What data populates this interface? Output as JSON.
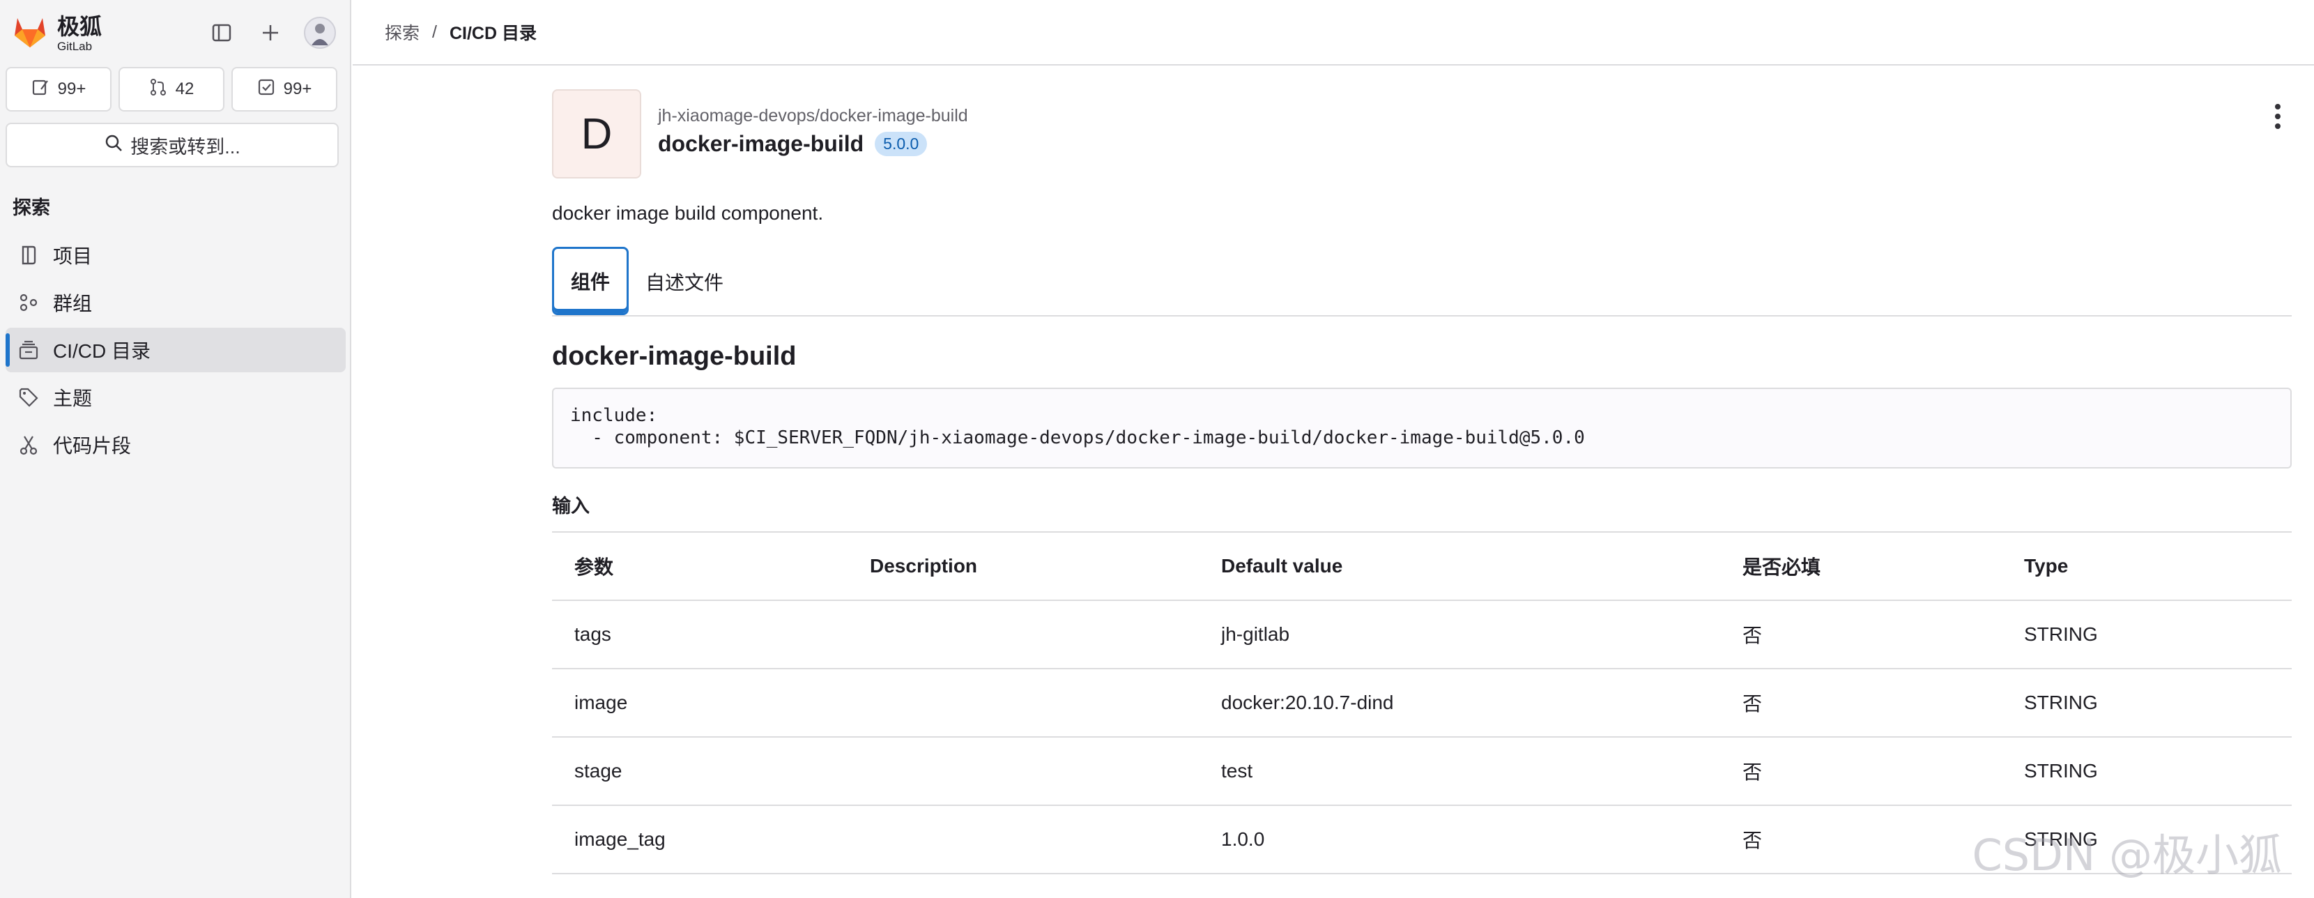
{
  "brand": {
    "name_cn": "极狐",
    "name_en": "GitLab"
  },
  "counters": [
    {
      "icon": "issues-icon",
      "value": "99+"
    },
    {
      "icon": "merge-request-icon",
      "value": "42"
    },
    {
      "icon": "todo-icon",
      "value": "99+"
    }
  ],
  "search": {
    "label": "搜索或转到..."
  },
  "sidebar": {
    "section": "探索",
    "items": [
      {
        "label": "项目",
        "icon": "project-icon"
      },
      {
        "label": "群组",
        "icon": "group-icon"
      },
      {
        "label": "CI/CD 目录",
        "icon": "catalog-icon",
        "active": true
      },
      {
        "label": "主题",
        "icon": "label-icon"
      },
      {
        "label": "代码片段",
        "icon": "snippet-icon"
      }
    ]
  },
  "breadcrumb": {
    "parent": "探索",
    "separator": "/",
    "current": "CI/CD 目录"
  },
  "project": {
    "avatar_letter": "D",
    "path": "jh-xiaomage-devops/docker-image-build",
    "name": "docker-image-build",
    "version": "5.0.0",
    "description": "docker image build component."
  },
  "tabs": [
    {
      "label": "组件",
      "active": true
    },
    {
      "label": "自述文件",
      "active": false
    }
  ],
  "component": {
    "title": "docker-image-build",
    "code": "include:\n  - component: $CI_SERVER_FQDN/jh-xiaomage-devops/docker-image-build/docker-image-build@5.0.0",
    "inputs_label": "输入",
    "table": {
      "headers": [
        "参数",
        "Description",
        "Default value",
        "是否必填",
        "Type"
      ],
      "rows": [
        [
          "tags",
          "",
          "jh-gitlab",
          "否",
          "STRING"
        ],
        [
          "image",
          "",
          "docker:20.10.7-dind",
          "否",
          "STRING"
        ],
        [
          "stage",
          "",
          "test",
          "否",
          "STRING"
        ],
        [
          "image_tag",
          "",
          "1.0.0",
          "否",
          "STRING"
        ]
      ]
    }
  },
  "watermark": "CSDN @极小狐",
  "colors": {
    "accent": "#1f75cb",
    "sidebar_bg": "#f4f4f5",
    "badge_bg": "#cbe2f9",
    "brand_orange": "#e24329"
  }
}
